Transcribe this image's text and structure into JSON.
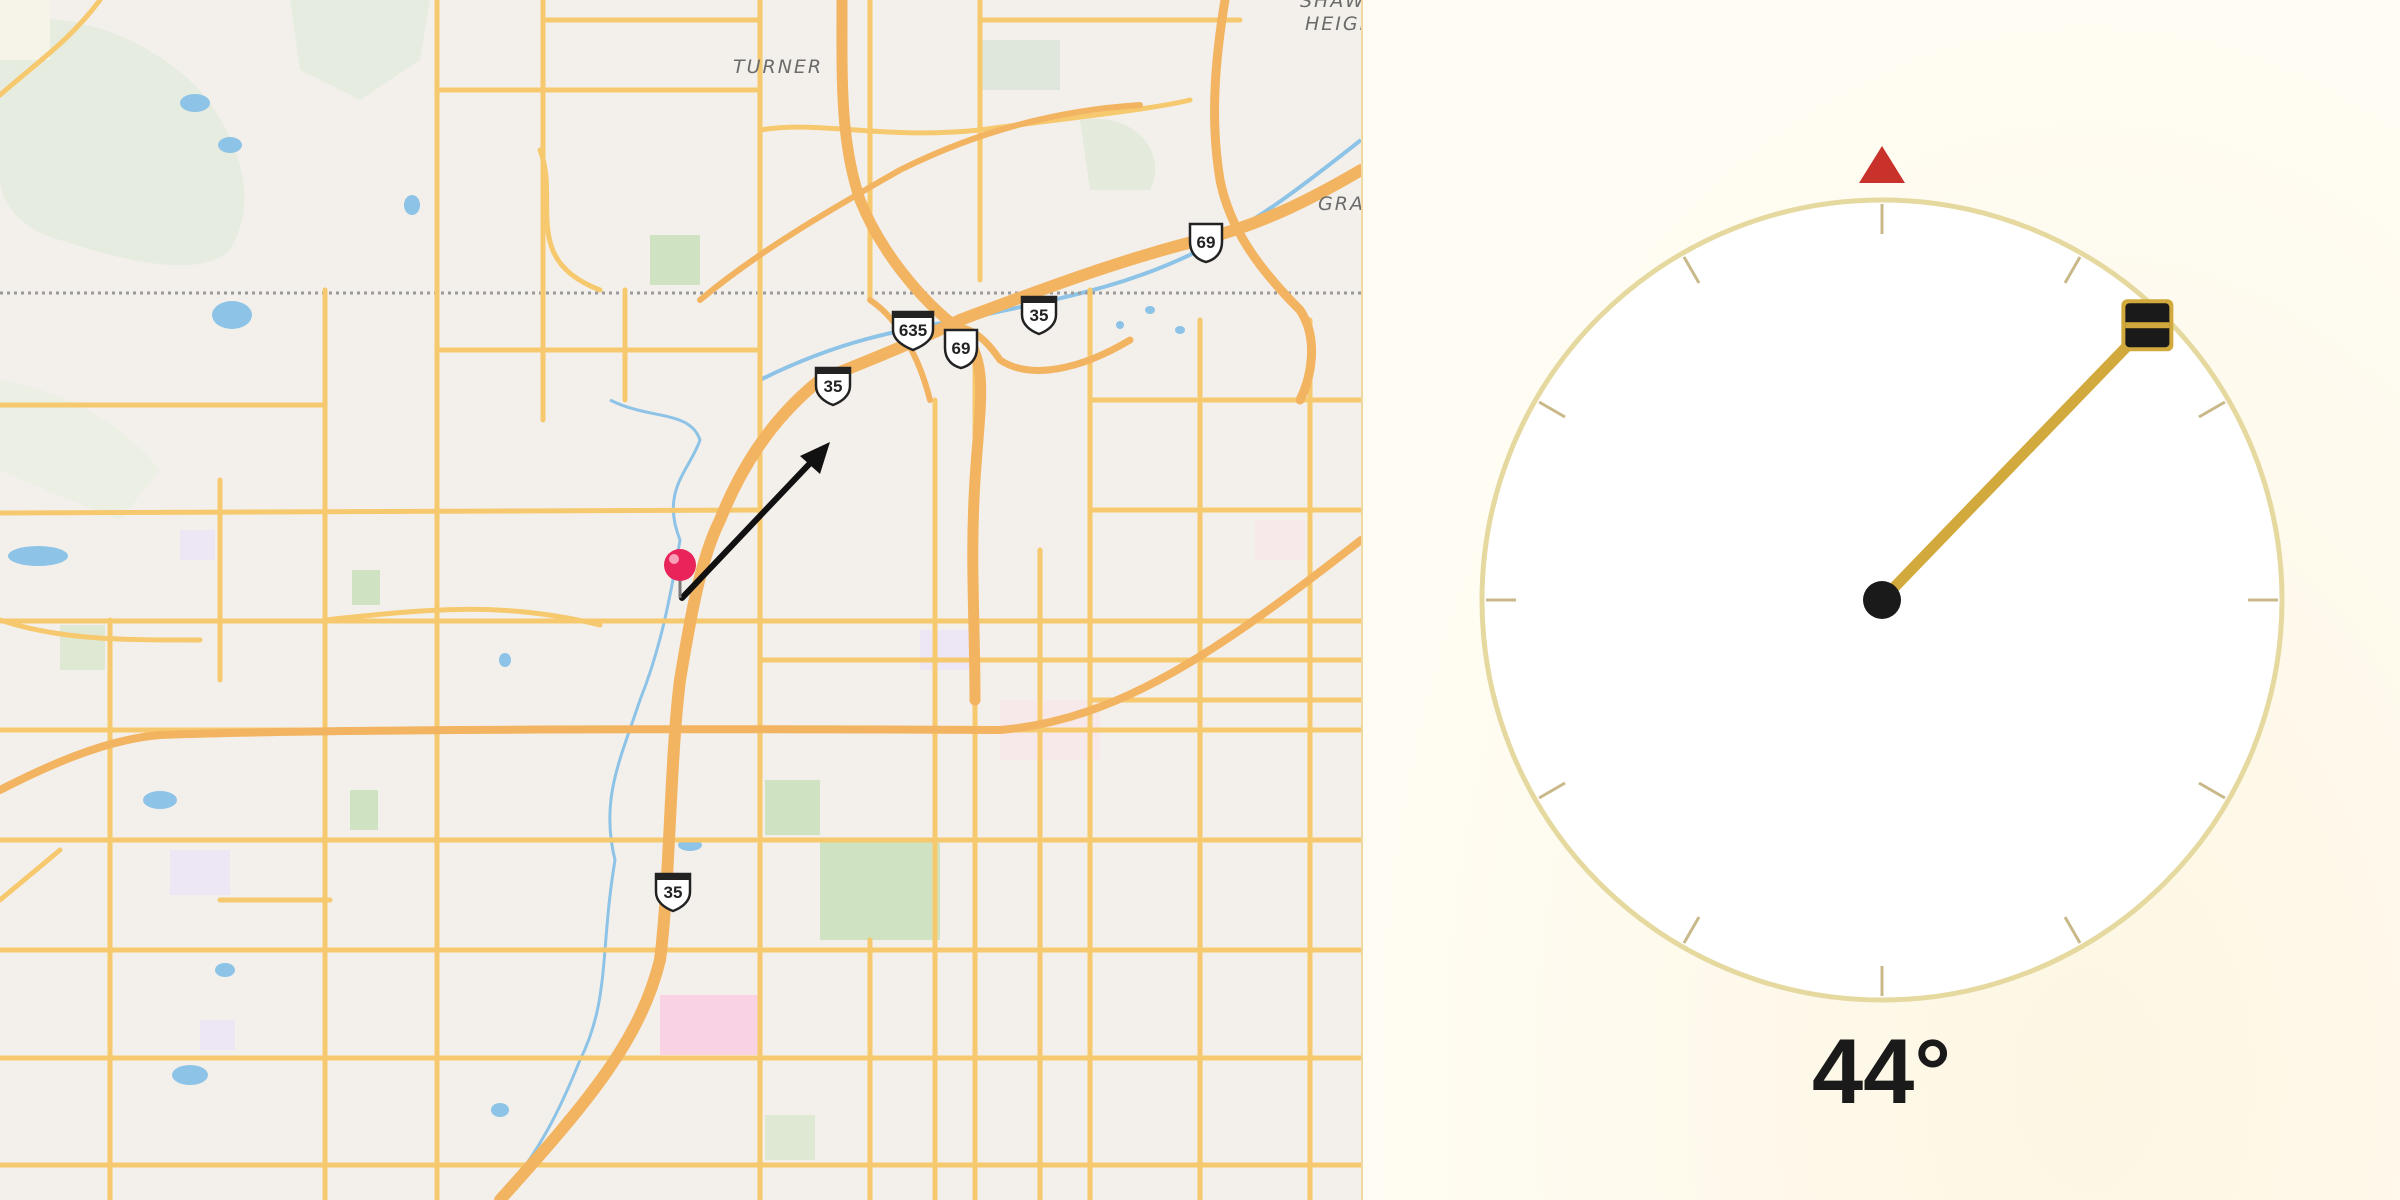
{
  "map": {
    "labels": {
      "turner": "TURNER",
      "shawnee_1": "SHAW",
      "shawnee_2": "HEIGH",
      "grand": "GRA"
    },
    "shields": [
      {
        "type": "interstate",
        "number": "635"
      },
      {
        "type": "us-highway",
        "number": "69"
      },
      {
        "type": "us-highway",
        "number": "69"
      },
      {
        "type": "interstate",
        "number": "35"
      },
      {
        "type": "interstate",
        "number": "35"
      },
      {
        "type": "interstate",
        "number": "35"
      }
    ],
    "marker": {
      "icon": "map-pin-icon",
      "color": "#e8245a"
    },
    "direction_arrow": {
      "icon": "direction-arrow-icon",
      "color": "#111111"
    },
    "colors": {
      "road": "#f6c96e",
      "highway": "#f2b461",
      "water": "#8cc3e6",
      "park": "#cfe2c1",
      "boundary": "#9a9a9a"
    }
  },
  "compass": {
    "heading_degrees": 44,
    "heading_text": "44°",
    "north_marker": {
      "icon": "north-triangle-icon",
      "color": "#c8322a"
    },
    "needle_color": "#d2a93c",
    "ring_color": "#e5d9a0",
    "handle": {
      "icon": "drag-handle-icon",
      "color": "#1a1a1a"
    }
  }
}
